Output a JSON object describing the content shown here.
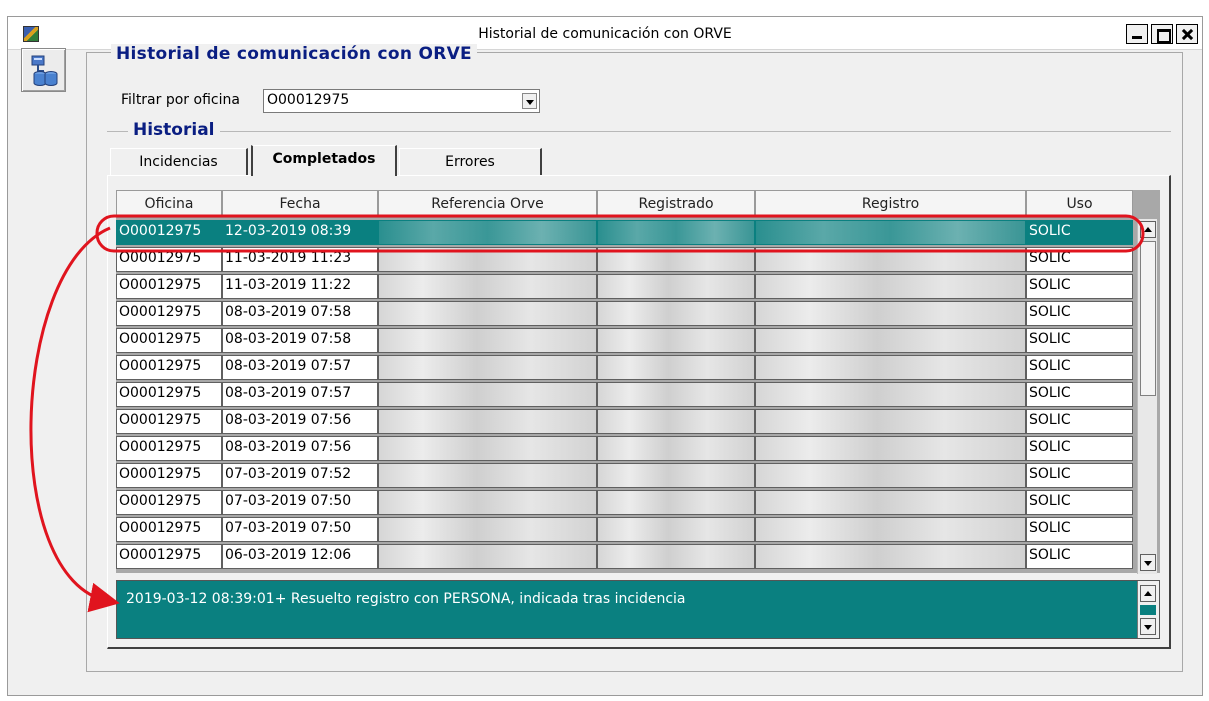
{
  "window": {
    "title": "Historial de comunicación con ORVE"
  },
  "group": {
    "title": "Historial de comunicación con ORVE",
    "filter_label": "Filtrar por oficina",
    "filter_value": "O00012975"
  },
  "history": {
    "title": "Historial",
    "tabs": [
      {
        "label": "Incidencias",
        "active": false
      },
      {
        "label": "Completados",
        "active": true
      },
      {
        "label": "Errores",
        "active": false
      }
    ],
    "columns": [
      "Oficina",
      "Fecha",
      "Referencia Orve",
      "Registrado",
      "Registro",
      "Uso"
    ],
    "rows": [
      {
        "oficina": "O00012975",
        "fecha": "12-03-2019 08:39",
        "uso": "SOLIC",
        "selected": true
      },
      {
        "oficina": "O00012975",
        "fecha": "11-03-2019 11:23",
        "uso": "SOLIC"
      },
      {
        "oficina": "O00012975",
        "fecha": "11-03-2019 11:22",
        "uso": "SOLIC"
      },
      {
        "oficina": "O00012975",
        "fecha": "08-03-2019 07:58",
        "uso": "SOLIC"
      },
      {
        "oficina": "O00012975",
        "fecha": "08-03-2019 07:58",
        "uso": "SOLIC"
      },
      {
        "oficina": "O00012975",
        "fecha": "08-03-2019 07:57",
        "uso": "SOLIC"
      },
      {
        "oficina": "O00012975",
        "fecha": "08-03-2019 07:57",
        "uso": "SOLIC"
      },
      {
        "oficina": "O00012975",
        "fecha": "08-03-2019 07:56",
        "uso": "SOLIC"
      },
      {
        "oficina": "O00012975",
        "fecha": "08-03-2019 07:56",
        "uso": "SOLIC"
      },
      {
        "oficina": "O00012975",
        "fecha": "07-03-2019 07:52",
        "uso": "SOLIC"
      },
      {
        "oficina": "O00012975",
        "fecha": "07-03-2019 07:50",
        "uso": "SOLIC"
      },
      {
        "oficina": "O00012975",
        "fecha": "07-03-2019 07:50",
        "uso": "SOLIC"
      },
      {
        "oficina": "O00012975",
        "fecha": "06-03-2019 12:06",
        "uso": "SOLIC"
      }
    ],
    "message": "2019-03-12 08:39:01+ Resuelto registro con PERSONA, indicada tras incidencia"
  },
  "colors": {
    "selection": "#0a8080",
    "heading": "#0a1e82",
    "annotation": "#e0141e"
  },
  "icons": {
    "app": "app-icon",
    "side": "database-transfer-icon",
    "minimize": "minimize-icon",
    "maximize": "maximize-icon",
    "close": "close-icon"
  }
}
